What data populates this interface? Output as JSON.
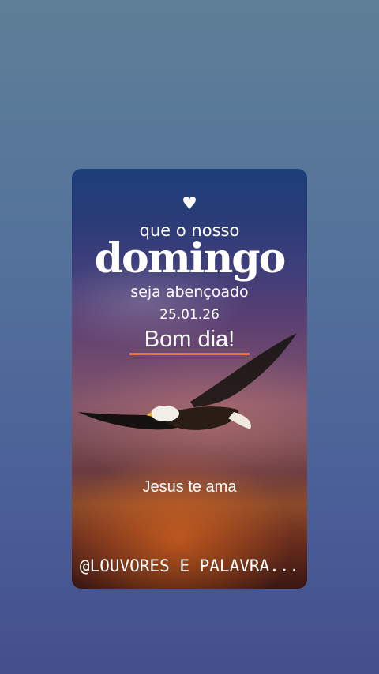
{
  "card": {
    "heart_icon": "heart-icon",
    "line1": "que o nosso",
    "line2": "domingo",
    "line3": "seja abençoado",
    "date": "25.01.26",
    "greeting": "Bom dia!",
    "message": "Jesus te ama",
    "handle": "@LOUVORES E PALAVRA...",
    "underline_color": "#e8772a"
  }
}
